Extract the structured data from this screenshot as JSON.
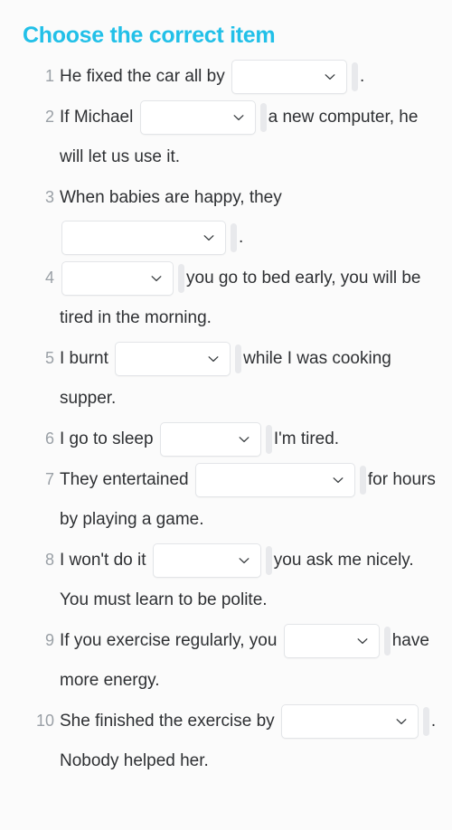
{
  "page": {
    "title": "Choose the correct item",
    "title_color": "#22c0e8",
    "background_color": "#fbfbfb",
    "text_color": "#2e3033",
    "number_color": "#9aa0a6"
  },
  "dropdown": {
    "icon": "chevron-down-icon",
    "value": "",
    "placeholder": "",
    "border_color": "#e3e5e8",
    "background_color": "#ffffff"
  },
  "questions": [
    {
      "number": "1",
      "before": "He fixed the car all by",
      "after": ".",
      "select_value": "",
      "select_width": 128
    },
    {
      "number": "2",
      "before": "If Michael",
      "after": "a new computer, he will let us use it.",
      "select_value": "",
      "select_width": 128
    },
    {
      "number": "3",
      "before": "When babies are happy, they",
      "after": ".",
      "select_value": "",
      "select_width": 182
    },
    {
      "number": "4",
      "before": "",
      "after": "you go to bed early, you will be tired in the morning.",
      "select_value": "",
      "select_width": 124
    },
    {
      "number": "5",
      "before": "I burnt",
      "after": "while I was cooking supper.",
      "select_value": "",
      "select_width": 128
    },
    {
      "number": "6",
      "before": "I go to sleep",
      "after": "I'm tired.",
      "select_value": "",
      "select_width": 112
    },
    {
      "number": "7",
      "before": "They entertained",
      "after": "for hours by playing a game.",
      "select_value": "",
      "select_width": 177
    },
    {
      "number": "8",
      "before": "I won't do it",
      "after": "you ask me nicely. You must learn to be polite.",
      "select_value": "",
      "select_width": 120
    },
    {
      "number": "9",
      "before": "If you exercise regularly, you",
      "after": "have more energy.",
      "select_value": "",
      "select_width": 106
    },
    {
      "number": "10",
      "before": "She finished the exercise by",
      "after": ". Nobody helped her.",
      "select_value": "",
      "select_width": 152
    }
  ]
}
